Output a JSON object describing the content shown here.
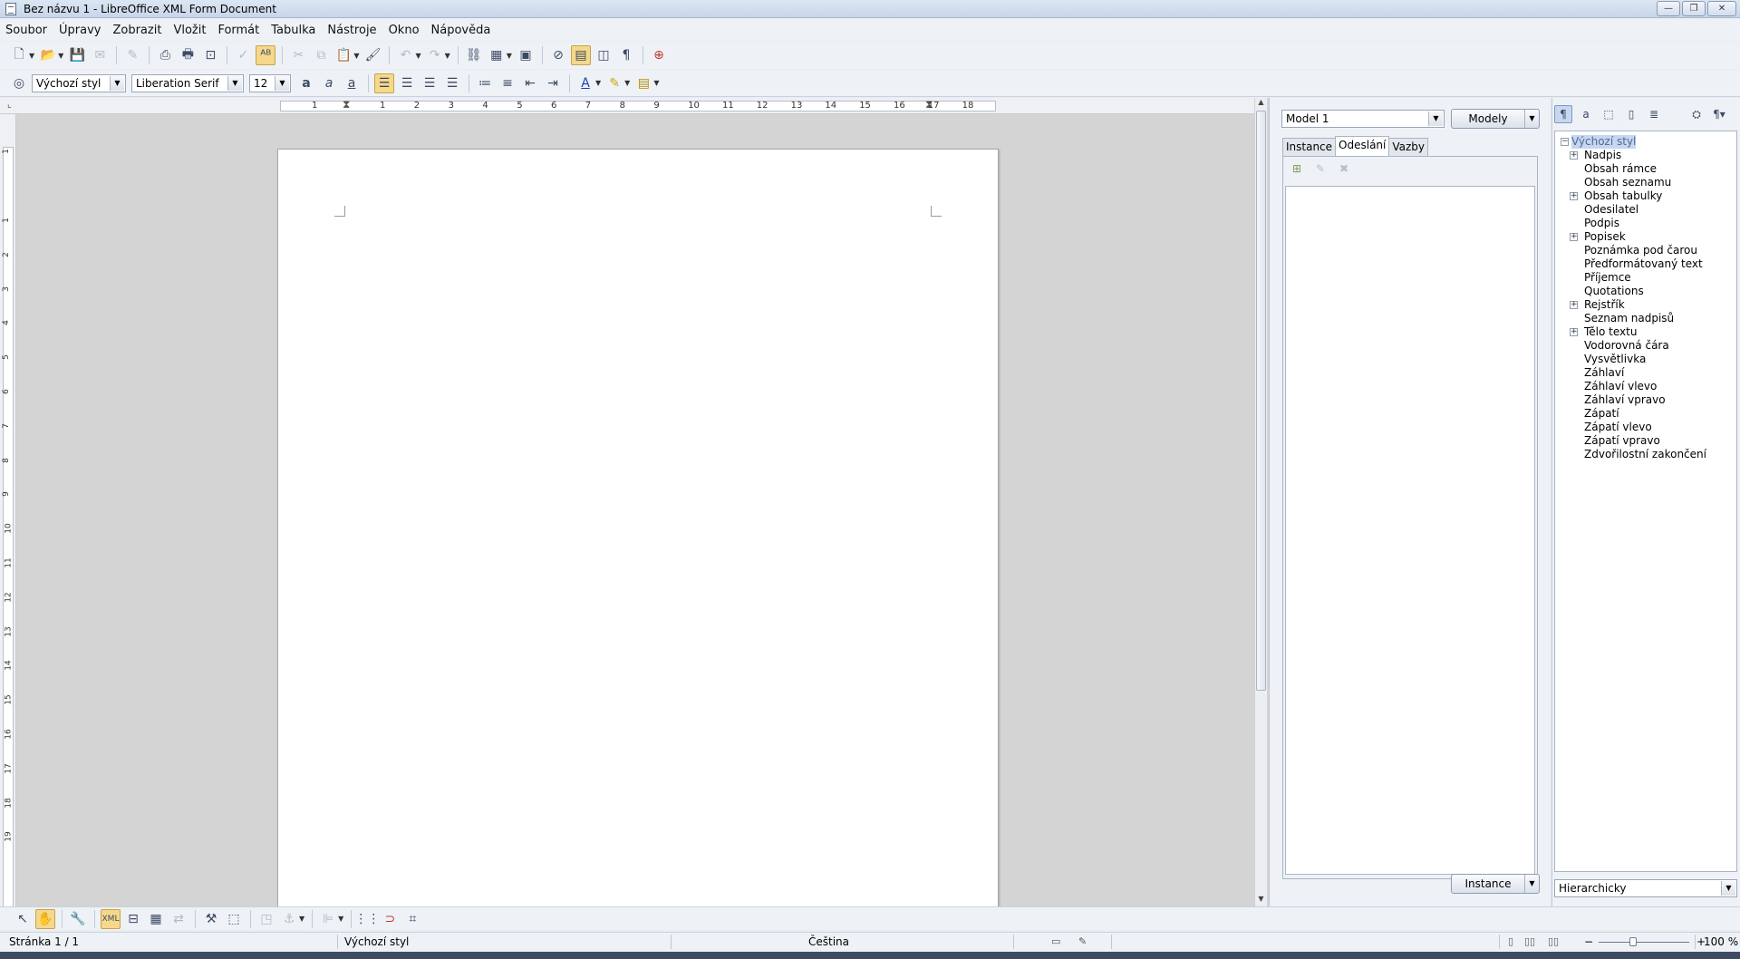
{
  "window": {
    "title": "Bez názvu 1 - LibreOffice XML Form Document",
    "minimize": "—",
    "restore": "❐",
    "close": "✕"
  },
  "menu": [
    "Soubor",
    "Úpravy",
    "Zobrazit",
    "Vložit",
    "Formát",
    "Tabulka",
    "Nástroje",
    "Okno",
    "Nápověda"
  ],
  "formatting": {
    "paragraph_style": "Výchozí styl",
    "font_name": "Liberation Serif",
    "font_size": "12"
  },
  "ruler": {
    "horizontal_numbers": [
      "1",
      "1",
      "2",
      "3",
      "4",
      "5",
      "6",
      "7",
      "8",
      "9",
      "10",
      "11",
      "12",
      "13",
      "14",
      "15",
      "16",
      "17",
      "18"
    ],
    "vertical_numbers": [
      "1",
      "1",
      "2",
      "3",
      "4",
      "5",
      "6",
      "7",
      "8",
      "9",
      "10",
      "11",
      "12",
      "13",
      "14",
      "15",
      "16",
      "17",
      "18",
      "19"
    ]
  },
  "xml_panel": {
    "model": "Model 1",
    "models_button": "Modely",
    "tabs": [
      "Instance",
      "Odeslání",
      "Vazby"
    ],
    "selected_tab": "Odeslání",
    "instance_button": "Instance"
  },
  "styles_panel": {
    "items": [
      {
        "label": "Výchozí styl",
        "expander": "minus",
        "level": 0,
        "selected": true
      },
      {
        "label": "Nadpis",
        "expander": "plus",
        "level": 1
      },
      {
        "label": "Obsah rámce",
        "expander": "",
        "level": 1
      },
      {
        "label": "Obsah seznamu",
        "expander": "",
        "level": 1
      },
      {
        "label": "Obsah tabulky",
        "expander": "plus",
        "level": 1
      },
      {
        "label": "Odesilatel",
        "expander": "",
        "level": 1
      },
      {
        "label": "Podpis",
        "expander": "",
        "level": 1
      },
      {
        "label": "Popisek",
        "expander": "plus",
        "level": 1
      },
      {
        "label": "Poznámka pod čarou",
        "expander": "",
        "level": 1
      },
      {
        "label": "Předformátovaný text",
        "expander": "",
        "level": 1
      },
      {
        "label": "Příjemce",
        "expander": "",
        "level": 1
      },
      {
        "label": "Quotations",
        "expander": "",
        "level": 1
      },
      {
        "label": "Rejstřík",
        "expander": "plus",
        "level": 1
      },
      {
        "label": "Seznam nadpisů",
        "expander": "",
        "level": 1
      },
      {
        "label": "Tělo textu",
        "expander": "plus",
        "level": 1
      },
      {
        "label": "Vodorovná čára",
        "expander": "",
        "level": 1
      },
      {
        "label": "Vysvětlivka",
        "expander": "",
        "level": 1
      },
      {
        "label": "Záhlaví",
        "expander": "",
        "level": 1
      },
      {
        "label": "Záhlaví vlevo",
        "expander": "",
        "level": 1
      },
      {
        "label": "Záhlaví vpravo",
        "expander": "",
        "level": 1
      },
      {
        "label": "Zápatí",
        "expander": "",
        "level": 1
      },
      {
        "label": "Zápatí vlevo",
        "expander": "",
        "level": 1
      },
      {
        "label": "Zápatí vpravo",
        "expander": "",
        "level": 1
      },
      {
        "label": "Zdvořilostní zakončení",
        "expander": "",
        "level": 1
      }
    ],
    "filter": "Hierarchicky"
  },
  "status": {
    "page": "Stránka 1 / 1",
    "style": "Výchozí styl",
    "language": "Čeština",
    "zoom": "100 %",
    "zoom_out": "−",
    "zoom_in": "+"
  },
  "colors": {
    "accent_selection": "#c7d7ef",
    "active_tool": "#f5d88a",
    "workspace": "#d4d4d4"
  }
}
